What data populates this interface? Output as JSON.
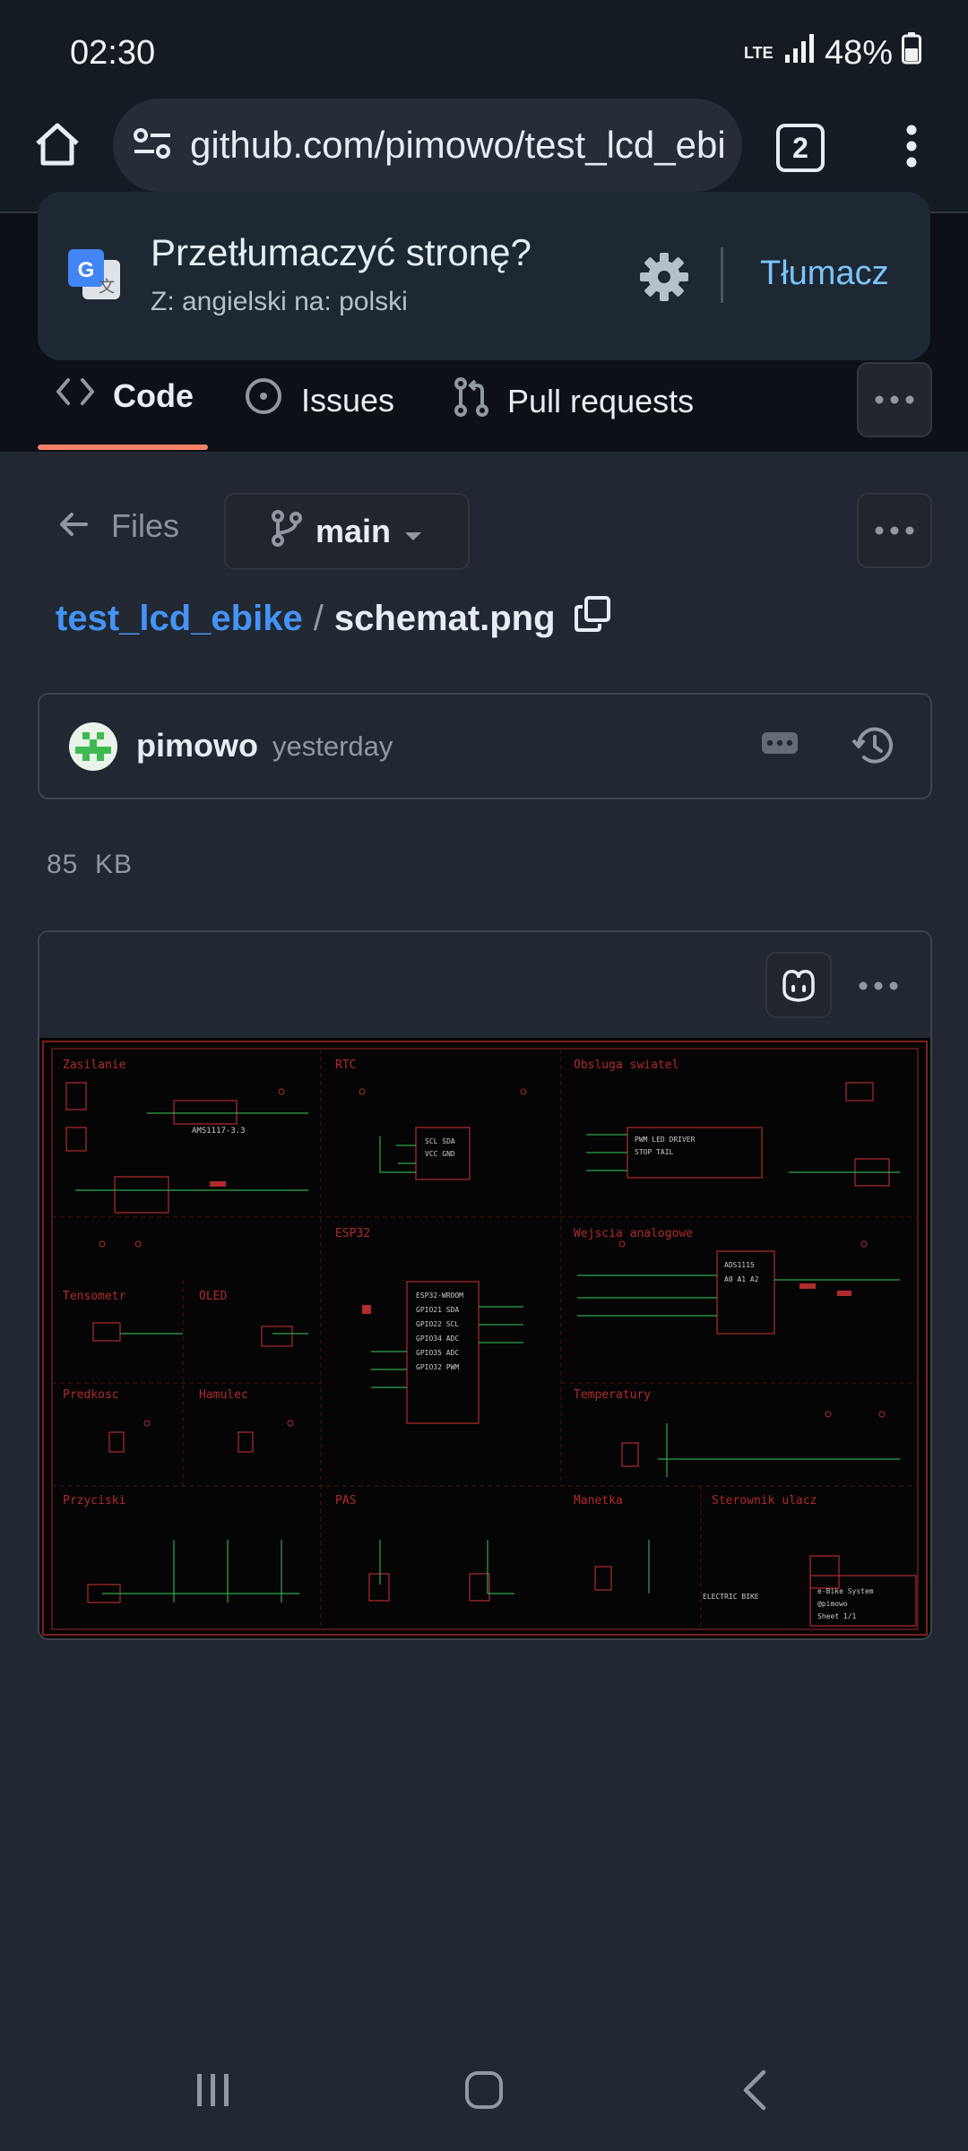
{
  "status_bar": {
    "time": "02:30",
    "network": "LTE",
    "battery": "48%"
  },
  "browser": {
    "url": "github.com/pimowo/test_lcd_ebike",
    "tab_count": "2"
  },
  "translate_popup": {
    "title": "Przetłumaczyć stronę?",
    "subtitle": "Z: angielski na: polski",
    "translate_button": "Tłumacz"
  },
  "repo_nav": {
    "tabs": [
      {
        "label": "Code"
      },
      {
        "label": "Issues"
      },
      {
        "label": "Pull requests"
      }
    ]
  },
  "file_nav": {
    "files_label": "Files",
    "branch": "main"
  },
  "breadcrumb": {
    "repo": "test_lcd_ebike",
    "separator": "/",
    "file": "schemat.png"
  },
  "commit": {
    "author": "pimowo",
    "time": "yesterday"
  },
  "file_size": "85  KB",
  "schematic": {
    "sections": [
      "Zasilanie",
      "RTC",
      "Obsluga swiatel",
      "ESP32",
      "Wejscia analogowe",
      "Tensometr",
      "OLED",
      "Predkosc",
      "Hamulec",
      "Temperatury",
      "Przyciski",
      "PAS",
      "Manetka",
      "Sterownik ulacz"
    ],
    "regulator_label": "AMS1117-3.3"
  },
  "colors": {
    "accent": "#f78166",
    "link": "#4493f8",
    "translate": "#7cc4fa",
    "schematic_red": "#b02b2b",
    "schematic_green": "#2fa84f"
  }
}
